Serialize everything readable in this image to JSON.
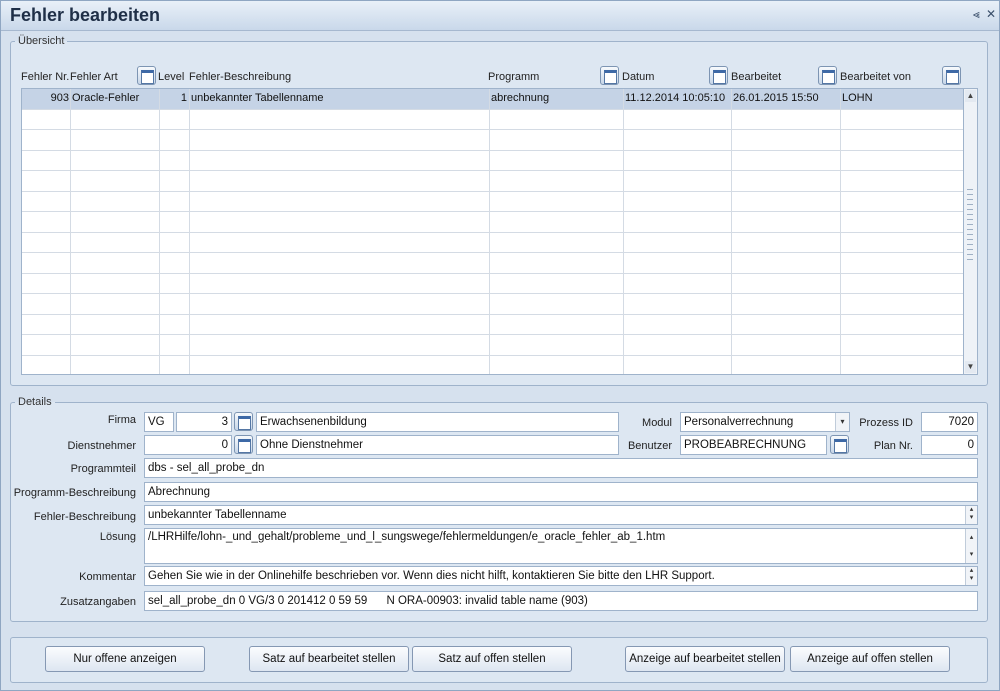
{
  "window": {
    "title": "Fehler bearbeiten",
    "minimize_glyph": "⪡",
    "close_glyph": "✕"
  },
  "overview": {
    "legend": "Übersicht",
    "columns": {
      "fehler_nr": "Fehler Nr.",
      "fehler_art": "Fehler Art",
      "level": "Level",
      "beschreibung": "Fehler-Beschreibung",
      "programm": "Programm",
      "datum": "Datum",
      "bearbeitet": "Bearbeitet",
      "bearbeitet_von": "Bearbeitet von"
    },
    "rows": [
      {
        "fehler_nr": "903",
        "fehler_art": "Oracle-Fehler",
        "level": "1",
        "beschreibung": "unbekannter Tabellenname",
        "programm": "abrechnung",
        "datum": "11.12.2014 10:05:10",
        "bearbeitet": "26.01.2015 15:50",
        "bearbeitet_von": "LOHN"
      }
    ]
  },
  "details": {
    "legend": "Details",
    "firma": {
      "label": "Firma",
      "code": "VG",
      "number": "3",
      "name": "Erwachsenenbildung"
    },
    "dienstnehmer": {
      "label": "Dienstnehmer",
      "number": "0",
      "name": "Ohne Dienstnehmer"
    },
    "modul": {
      "label": "Modul",
      "value": "Personalverrechnung"
    },
    "benutzer": {
      "label": "Benutzer",
      "value": "PROBEABRECHNUNG"
    },
    "prozess_id": {
      "label": "Prozess ID",
      "value": "7020"
    },
    "plan_nr": {
      "label": "Plan Nr.",
      "value": "0"
    },
    "programmteil": {
      "label": "Programmteil",
      "value": "dbs - sel_all_probe_dn"
    },
    "programm_beschreibung": {
      "label": "Programm-Beschreibung",
      "value": "Abrechnung"
    },
    "fehler_beschreibung": {
      "label": "Fehler-Beschreibung",
      "value": "unbekannter Tabellenname"
    },
    "loesung": {
      "label": "Lösung",
      "value": "/LHRHilfe/lohn-_und_gehalt/probleme_und_l_sungswege/fehlermeldungen/e_oracle_fehler_ab_1.htm"
    },
    "kommentar": {
      "label": "Kommentar",
      "value": "Gehen Sie wie in der Onlinehilfe beschrieben vor. Wenn dies nicht hilft, kontaktieren Sie bitte den LHR Support."
    },
    "zusatzangaben": {
      "label": "Zusatzangaben",
      "value": "sel_all_probe_dn 0 VG/3 0 201412 0 59 59      N ORA-00903: invalid table name (903)"
    }
  },
  "buttons": {
    "nur_offene": "Nur offene anzeigen",
    "satz_bearbeitet": "Satz auf bearbeitet stellen",
    "satz_offen": "Satz auf offen stellen",
    "anzeige_bearbeitet": "Anzeige auf bearbeitet stellen",
    "anzeige_offen": "Anzeige auf offen stellen"
  },
  "icons": {
    "scroll_up": "▲",
    "scroll_down": "▼",
    "spin_up": "▴",
    "spin_down": "▾",
    "dropdown": "▾"
  },
  "colors": {
    "window_bg": "#d6e1ee",
    "selected_row": "#c5d3e6",
    "title_text": "#1f2f47"
  }
}
